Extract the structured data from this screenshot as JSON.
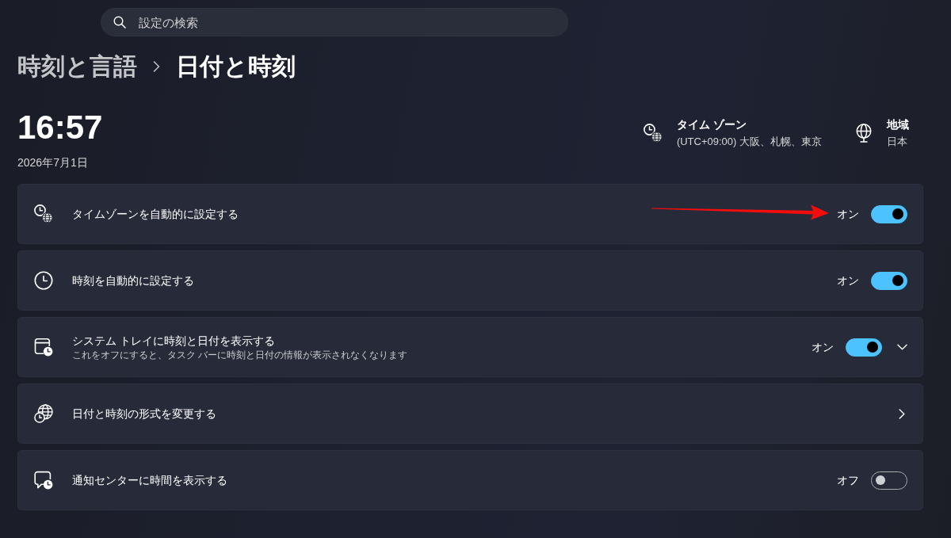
{
  "search": {
    "placeholder": "設定の検索"
  },
  "breadcrumb": [
    {
      "label": "時刻と言語",
      "current": false
    },
    {
      "label": "日付と時刻",
      "current": true
    }
  ],
  "clock": {
    "time": "16:57",
    "date": "2026年7月1日"
  },
  "info": [
    {
      "kind": "time_zone",
      "title": "タイム ゾーン",
      "value": "(UTC+09:00) 大阪、札幌、東京"
    },
    {
      "kind": "region",
      "title": "地域",
      "value": "日本"
    }
  ],
  "settings": [
    {
      "kind": "toggle",
      "label": "タイムゾーンを自動的に設定する",
      "state_label": "オン",
      "on": true,
      "arrow_marked": true
    },
    {
      "kind": "toggle",
      "label": "時刻を自動的に設定する",
      "state_label": "オン",
      "on": true,
      "arrow_marked": false
    },
    {
      "kind": "expander",
      "label": "システム トレイに時刻と日付を表示する",
      "description": "これをオフにすると、タスク バーに時刻と日付の情報が表示されなくなります",
      "state_label": "オン",
      "on": true,
      "expanded": false,
      "arrow_marked": false
    },
    {
      "kind": "link",
      "label": "日付と時刻の形式を変更する",
      "arrow_marked": false
    },
    {
      "kind": "toggle",
      "label": "通知センターに時間を表示する",
      "state_label": "オフ",
      "on": false,
      "arrow_marked": false
    }
  ]
}
